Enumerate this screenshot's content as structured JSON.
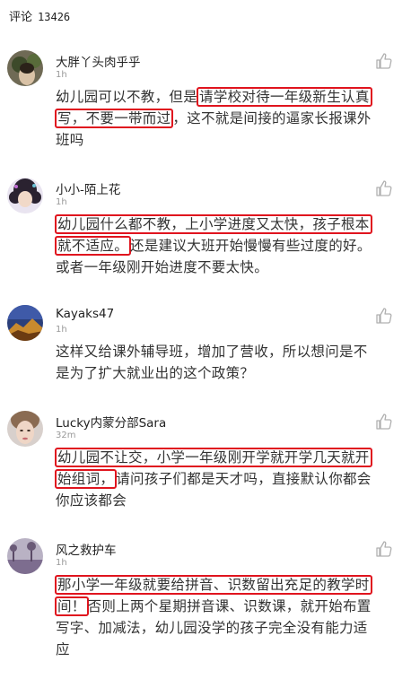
{
  "header": {
    "label": "评论",
    "count": "13426"
  },
  "comments": [
    {
      "name": "大胖丫头肉乎乎",
      "time": "1h",
      "lines": [
        {
          "plain_a": "幼儿园可以不教，但是",
          "hl": "请学校对待一年级新生认真",
          "plain_b": ""
        },
        {
          "plain_a": "",
          "hl": "写，不要一带而过",
          "plain_b": "，这不就是间接的逼家长报课外"
        },
        {
          "plain_a": "班吗",
          "hl": "",
          "plain_b": ""
        }
      ]
    },
    {
      "name": "小小-陌上花",
      "time": "1h",
      "lines": [
        {
          "plain_a": "",
          "hl": "幼儿园什么都不教，上小学进度又太快，孩子根本",
          "plain_b": ""
        },
        {
          "plain_a": "",
          "hl": "就不适应。",
          "plain_b": "还是建议大班开始慢慢有些过度的好。"
        },
        {
          "plain_a": "或者一年级刚开始进度不要太快。",
          "hl": "",
          "plain_b": ""
        }
      ]
    },
    {
      "name": "Kayaks47",
      "time": "1h",
      "lines": [
        {
          "plain_a": "这样又给课外辅导班，增加了营收，所以想问是不",
          "hl": "",
          "plain_b": ""
        },
        {
          "plain_a": "是为了扩大就业出的这个政策？",
          "hl": "",
          "plain_b": ""
        }
      ]
    },
    {
      "name": "Lucky内蒙分部Sara",
      "time": "32m",
      "lines": [
        {
          "plain_a": "",
          "hl": "幼儿园不让交，小学一年级刚开学就开学几天就开",
          "plain_b": ""
        },
        {
          "plain_a": "",
          "hl": "始组词，",
          "plain_b": "请问孩子们都是天才吗，直接默认你都会"
        },
        {
          "plain_a": "你应该都会",
          "hl": "",
          "plain_b": ""
        }
      ]
    },
    {
      "name": "风之救护车",
      "time": "1h",
      "lines": [
        {
          "plain_a": "",
          "hl": "那小学一年级就要给拼音、识数留出充足的教学时",
          "plain_b": ""
        },
        {
          "plain_a": "",
          "hl": "间！",
          "plain_b": "否则上两个星期拼音课、识数课，就开始布置"
        },
        {
          "plain_a": "写字、加减法，幼儿园没学的孩子完全没有能力适",
          "hl": "",
          "plain_b": ""
        },
        {
          "plain_a": "应",
          "hl": "",
          "plain_b": ""
        }
      ]
    }
  ],
  "icons": {
    "like": "thumbs-up-icon"
  },
  "colors": {
    "highlight_border": "#e0141e",
    "time": "#999999",
    "text": "#333333"
  }
}
